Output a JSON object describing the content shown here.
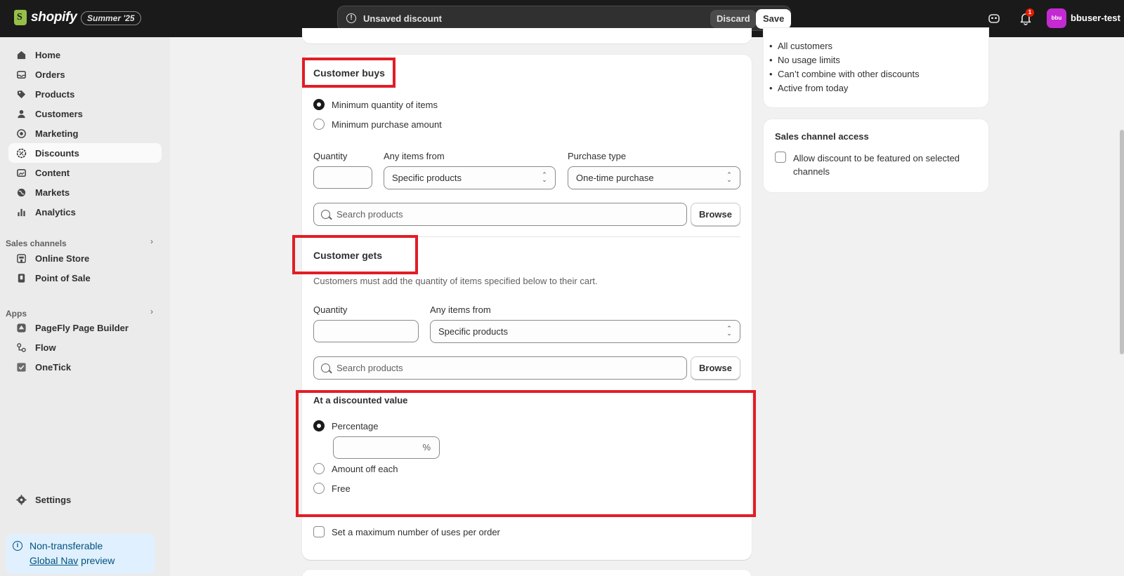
{
  "topbar": {
    "brand": "shopify",
    "edition": "Summer '25",
    "unsaved_text": "Unsaved discount",
    "discard_label": "Discard",
    "save_label": "Save",
    "notification_count": "1",
    "avatar_initials": "bbu",
    "username": "bbuser-test"
  },
  "sidebar": {
    "items": [
      {
        "label": "Home",
        "icon": "home-icon"
      },
      {
        "label": "Orders",
        "icon": "inbox-icon"
      },
      {
        "label": "Products",
        "icon": "tag-icon"
      },
      {
        "label": "Customers",
        "icon": "person-icon"
      },
      {
        "label": "Marketing",
        "icon": "target-icon"
      },
      {
        "label": "Discounts",
        "icon": "discount-icon",
        "active": true
      },
      {
        "label": "Content",
        "icon": "image-icon"
      },
      {
        "label": "Markets",
        "icon": "globe-icon"
      },
      {
        "label": "Analytics",
        "icon": "chart-icon"
      }
    ],
    "sales_channels_title": "Sales channels",
    "sales_channels": [
      {
        "label": "Online Store",
        "icon": "store-icon"
      },
      {
        "label": "Point of Sale",
        "icon": "pos-icon"
      }
    ],
    "apps_title": "Apps",
    "apps": [
      {
        "label": "PageFly Page Builder",
        "icon": "pagefly-icon"
      },
      {
        "label": "Flow",
        "icon": "flow-icon"
      },
      {
        "label": "OneTick",
        "icon": "onetick-icon"
      }
    ],
    "settings_label": "Settings",
    "notice_line1": "Non-transferable",
    "notice_link": "Global Nav",
    "notice_line2_suffix": " preview"
  },
  "customer_buys": {
    "title": "Customer buys",
    "options": [
      "Minimum quantity of items",
      "Minimum purchase amount"
    ],
    "selected_option": 0,
    "quantity_label": "Quantity",
    "quantity_value": "",
    "items_from_label": "Any items from",
    "items_from_value": "Specific products",
    "purchase_type_label": "Purchase type",
    "purchase_type_value": "One-time purchase",
    "search_placeholder": "Search products",
    "browse_label": "Browse"
  },
  "customer_gets": {
    "title": "Customer gets",
    "description": "Customers must add the quantity of items specified below to their cart.",
    "quantity_label": "Quantity",
    "quantity_value": "",
    "items_from_label": "Any items from",
    "items_from_value": "Specific products",
    "search_placeholder": "Search products",
    "browse_label": "Browse"
  },
  "discounted_value": {
    "title": "At a discounted value",
    "options": [
      "Percentage",
      "Amount off each",
      "Free"
    ],
    "selected_option": 0,
    "percent_suffix": "%",
    "percent_value": ""
  },
  "max_uses_label": "Set a maximum number of uses per order",
  "summary": {
    "bullets": [
      "All customers",
      "No usage limits",
      "Can’t combine with other discounts",
      "Active from today"
    ]
  },
  "sales_channel_access": {
    "title": "Sales channel access",
    "checkbox_label_line1": "Allow discount to be featured on selected",
    "checkbox_label_line2": "channels"
  },
  "colors": {
    "highlight": "#e11d26",
    "topbar": "#1a1a1a",
    "avatar": "#c42ad1",
    "brand_green": "#95bf47"
  }
}
